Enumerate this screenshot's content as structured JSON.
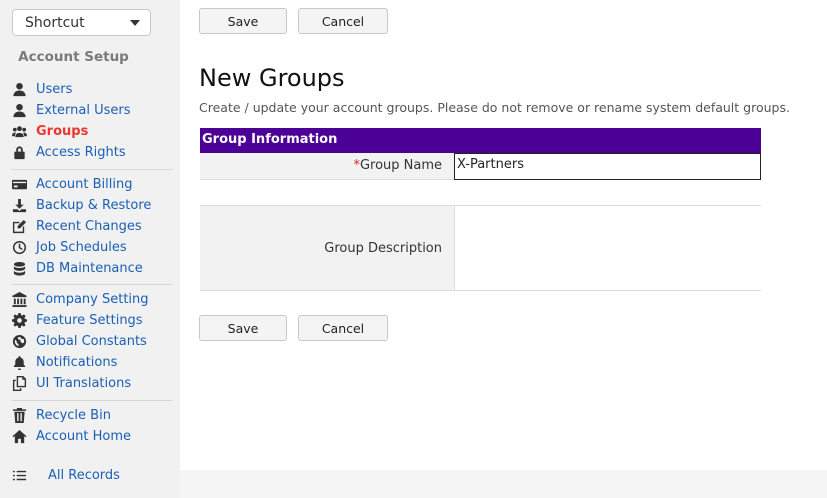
{
  "shortcut": {
    "value": "Shortcut"
  },
  "sidebar": {
    "section_title": "Account Setup",
    "groups": [
      [
        {
          "label": "Users",
          "icon": "user-icon"
        },
        {
          "label": "External Users",
          "icon": "user-icon"
        },
        {
          "label": "Groups",
          "icon": "users-icon",
          "active": true
        },
        {
          "label": "Access Rights",
          "icon": "lock-icon"
        }
      ],
      [
        {
          "label": "Account Billing",
          "icon": "credit-card-icon"
        },
        {
          "label": "Backup & Restore",
          "icon": "download-icon"
        },
        {
          "label": "Recent Changes",
          "icon": "edit-icon"
        },
        {
          "label": "Job Schedules",
          "icon": "clock-icon"
        },
        {
          "label": "DB Maintenance",
          "icon": "database-icon"
        }
      ],
      [
        {
          "label": "Company Setting",
          "icon": "bank-icon"
        },
        {
          "label": "Feature Settings",
          "icon": "gear-icon"
        },
        {
          "label": "Global Constants",
          "icon": "globe-icon"
        },
        {
          "label": "Notifications",
          "icon": "bell-icon"
        },
        {
          "label": "UI Translations",
          "icon": "copy-icon"
        }
      ],
      [
        {
          "label": "Recycle Bin",
          "icon": "trash-icon"
        },
        {
          "label": "Account Home",
          "icon": "home-icon"
        }
      ]
    ],
    "all_records": {
      "label": "All Records",
      "icon": "list-icon"
    }
  },
  "toolbar": {
    "save_label": "Save",
    "cancel_label": "Cancel"
  },
  "page": {
    "title": "New Groups",
    "description": "Create / update your account groups. Please do not remove or rename system default groups."
  },
  "form": {
    "header": "Group Information",
    "group_name": {
      "required_mark": "*",
      "label": "Group Name",
      "value": "X-Partners"
    },
    "group_description": {
      "label": "Group Description",
      "value": ""
    }
  },
  "colors": {
    "header_bg": "#4b0096",
    "link": "#1a5fb4",
    "active": "#e8382f",
    "required": "#d32626"
  }
}
